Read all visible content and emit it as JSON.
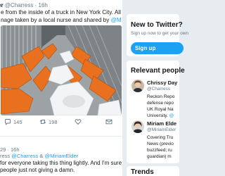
{
  "tweet": {
    "author": "er",
    "handle": "@Charress",
    "time": "· 16h",
    "text_line1": "e from the inside of a truck in New York City. All victims of",
    "text_line2_prefix": "nage taken by a local nurse and shared by ",
    "text_line2_mention": "@MiriamElder",
    "reply_count": "145",
    "retweet_count": "198"
  },
  "reply": {
    "time": "29 · 16h",
    "replying_prefix": "ress ",
    "replying_and": "& ",
    "mention1": "@Charress",
    "mention2": "@MiriamElder",
    "text_line1": "for everyone taking this thing lightly. And I'm sure we",
    "text_line2": "people just not giving a damn."
  },
  "sidebar": {
    "new_title": "New to Twitter?",
    "new_subtitle": "Sign up now to get your own",
    "signup_label": "Sign up",
    "relevant_title": "Relevant people",
    "people": [
      {
        "name": "Chrissy Day",
        "handle": "@Charress",
        "bio1": "Reckon Repo",
        "bio2": "defense repo",
        "bio3": "UK Royal Na",
        "bio4": "University. "
      },
      {
        "name": "Miriam Elde",
        "handle": "@MiriamElder",
        "bio1": "Covering Tru",
        "bio2": "News (previo",
        "bio3": "buzzfeed; ru",
        "bio4": "guardian) m"
      }
    ],
    "people_extra_mention": "@",
    "trends_title": "Trends"
  },
  "colors": {
    "accent": "#1da1f2",
    "background": "#e6ecf0"
  }
}
